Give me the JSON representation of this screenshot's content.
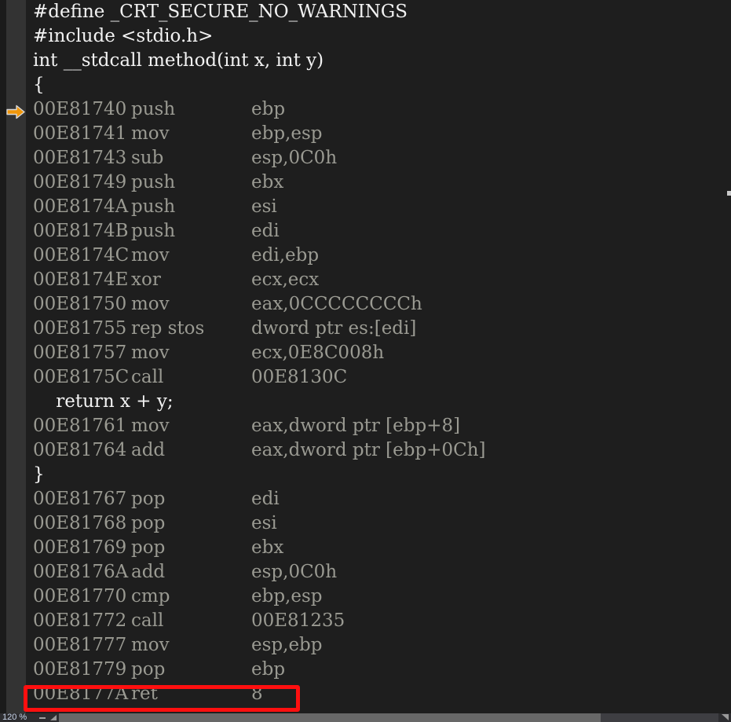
{
  "editor": {
    "kind": "disassembly-view",
    "colors": {
      "background": "#1e1e1e",
      "gutter": "#333333",
      "disassembly_text": "#9a9a92",
      "source_text": "#f2f2f2",
      "annotation": "#ff0f0f",
      "instruction_pointer": "#f0960a"
    },
    "lines": [
      {
        "type": "source",
        "text": "#define _CRT_SECURE_NO_WARNINGS"
      },
      {
        "type": "source",
        "text": "#include <stdio.h>"
      },
      {
        "type": "source",
        "text": "int __stdcall method(int x, int y)"
      },
      {
        "type": "source",
        "text": "{"
      },
      {
        "type": "asm",
        "current": true,
        "address": "00E81740",
        "mnemonic": "push",
        "operands": "ebp"
      },
      {
        "type": "asm",
        "address": "00E81741",
        "mnemonic": "mov",
        "operands": "ebp,esp"
      },
      {
        "type": "asm",
        "address": "00E81743",
        "mnemonic": "sub",
        "operands": "esp,0C0h"
      },
      {
        "type": "asm",
        "address": "00E81749",
        "mnemonic": "push",
        "operands": "ebx"
      },
      {
        "type": "asm",
        "address": "00E8174A",
        "mnemonic": "push",
        "operands": "esi"
      },
      {
        "type": "asm",
        "address": "00E8174B",
        "mnemonic": "push",
        "operands": "edi"
      },
      {
        "type": "asm",
        "address": "00E8174C",
        "mnemonic": "mov",
        "operands": "edi,ebp"
      },
      {
        "type": "asm",
        "address": "00E8174E",
        "mnemonic": "xor",
        "operands": "ecx,ecx"
      },
      {
        "type": "asm",
        "address": "00E81750",
        "mnemonic": "mov",
        "operands": "eax,0CCCCCCCCh"
      },
      {
        "type": "asm",
        "address": "00E81755",
        "mnemonic": "rep stos",
        "operands": "dword ptr es:[edi]"
      },
      {
        "type": "asm",
        "address": "00E81757",
        "mnemonic": "mov",
        "operands": "ecx,0E8C008h"
      },
      {
        "type": "asm",
        "address": "00E8175C",
        "mnemonic": "call",
        "operands": "00E8130C"
      },
      {
        "type": "source",
        "text": "    return x + y;"
      },
      {
        "type": "asm",
        "address": "00E81761",
        "mnemonic": "mov",
        "operands": "eax,dword ptr [ebp+8]"
      },
      {
        "type": "asm",
        "address": "00E81764",
        "mnemonic": "add",
        "operands": "eax,dword ptr [ebp+0Ch]"
      },
      {
        "type": "source",
        "text": "}"
      },
      {
        "type": "asm",
        "address": "00E81767",
        "mnemonic": "pop",
        "operands": "edi"
      },
      {
        "type": "asm",
        "address": "00E81768",
        "mnemonic": "pop",
        "operands": "esi"
      },
      {
        "type": "asm",
        "address": "00E81769",
        "mnemonic": "pop",
        "operands": "ebx"
      },
      {
        "type": "asm",
        "address": "00E8176A",
        "mnemonic": "add",
        "operands": "esp,0C0h"
      },
      {
        "type": "asm",
        "address": "00E81770",
        "mnemonic": "cmp",
        "operands": "ebp,esp"
      },
      {
        "type": "asm",
        "address": "00E81772",
        "mnemonic": "call",
        "operands": "00E81235"
      },
      {
        "type": "asm",
        "address": "00E81777",
        "mnemonic": "mov",
        "operands": "esp,ebp"
      },
      {
        "type": "asm",
        "address": "00E81779",
        "mnemonic": "pop",
        "operands": "ebp"
      },
      {
        "type": "asm",
        "address": "00E8177A",
        "mnemonic": "ret",
        "operands": "8",
        "annotated": true
      }
    ]
  },
  "annotation": {
    "target_line": "00E8177A   ret   8",
    "shape": "rectangle",
    "color": "#ff0f0f"
  },
  "bottom_bar": {
    "zoom_level": "120 %",
    "zoom_out_label": "-",
    "scroll_left_label": "◀",
    "scroll_right_label": "▶"
  }
}
